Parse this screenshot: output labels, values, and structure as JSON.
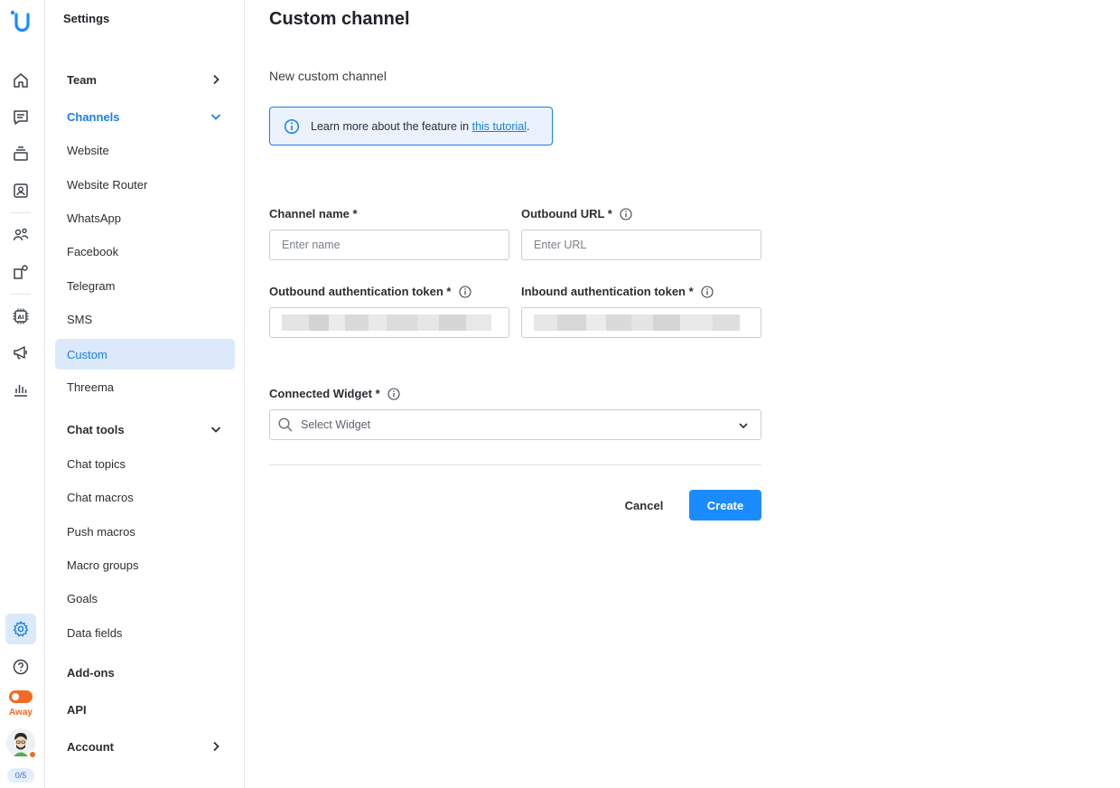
{
  "rail": {
    "logo": "userlike-logo",
    "icons": [
      "home-icon",
      "chat-icon",
      "inbox-stack-icon",
      "contacts-icon",
      "team-icon",
      "apps-icon",
      "ai-chip-icon",
      "megaphone-icon",
      "analytics-icon",
      "settings-icon",
      "help-icon"
    ],
    "status_label": "Away",
    "chat_counter": "0/5",
    "status_color": "#f26b21",
    "accent": "#1a7fe6"
  },
  "sidebar": {
    "title": "Settings",
    "team": "Team",
    "channels": "Channels",
    "channel_items": [
      "Website",
      "Website Router",
      "WhatsApp",
      "Facebook",
      "Telegram",
      "SMS",
      "Custom",
      "Threema"
    ],
    "chat_tools": "Chat tools",
    "chat_tool_items": [
      "Chat topics",
      "Chat macros",
      "Push macros",
      "Macro groups",
      "Goals",
      "Data fields"
    ],
    "addons": "Add-ons",
    "api": "API",
    "account": "Account",
    "selected": "Custom"
  },
  "main": {
    "title": "Custom channel",
    "subtitle": "New custom channel",
    "info_text": "Learn more about the feature in ",
    "info_link": "this tutorial",
    "info_end": ".",
    "channel_name_label": "Channel name *",
    "channel_name_placeholder": "Enter name",
    "outbound_url_label": "Outbound URL *",
    "outbound_url_placeholder": "Enter URL",
    "outbound_token_label": "Outbound authentication token *",
    "inbound_token_label": "Inbound authentication token *",
    "connected_widget_label": "Connected Widget *",
    "widget_placeholder": "Select Widget",
    "cancel": "Cancel",
    "create": "Create"
  }
}
